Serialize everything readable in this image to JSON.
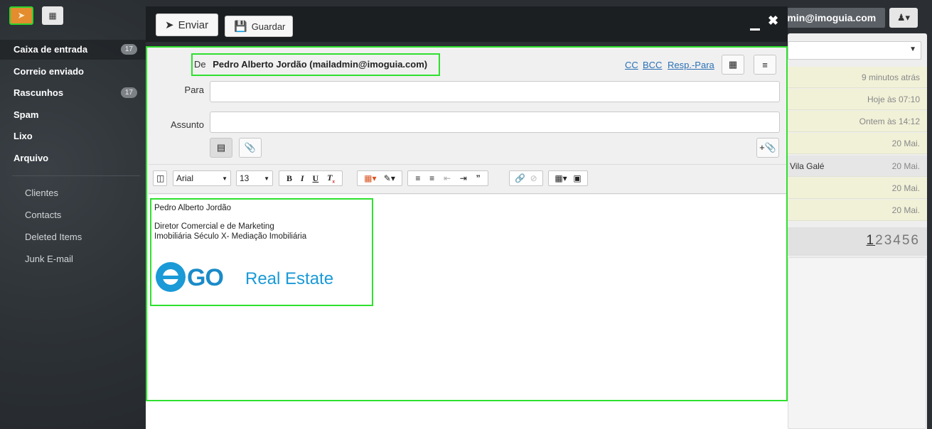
{
  "sidebar": {
    "folders": [
      {
        "label": "Caixa de entrada",
        "badge": "17"
      },
      {
        "label": "Correio enviado"
      },
      {
        "label": "Rascunhos",
        "badge": "17"
      },
      {
        "label": "Spam"
      },
      {
        "label": "Lixo"
      },
      {
        "label": "Arquivo"
      }
    ],
    "subfolders": [
      "Clientes",
      "Contacts",
      "Deleted Items",
      "Junk E-mail"
    ]
  },
  "user": {
    "email": "mailadmin@imoguia.com"
  },
  "message_list": {
    "rows": [
      {
        "subject": "",
        "when": "9 minutos atrás"
      },
      {
        "subject": "",
        "when": "Hoje às 07:10"
      },
      {
        "subject": "",
        "when": "Ontem às 14:12"
      },
      {
        "subject": "",
        "when": "20 Mai."
      },
      {
        "subject": "Vila Galé",
        "when": "20 Mai."
      },
      {
        "subject": "",
        "when": "20 Mai."
      },
      {
        "subject": "",
        "when": "20 Mai."
      }
    ],
    "pages": [
      "1",
      "2",
      "3",
      "4",
      "5",
      "6"
    ]
  },
  "compose": {
    "send_label": "Enviar",
    "save_label": "Guardar",
    "from_label": "De",
    "from_value": "Pedro Alberto Jordão (mailadmin@imoguia.com)",
    "cc_label": "CC",
    "bcc_label": "BCC",
    "reply_to_label": "Resp.-Para",
    "to_label": "Para",
    "to_value": "",
    "subject_label": "Assunto",
    "subject_value": ""
  },
  "editor_toolbar": {
    "font": "Arial",
    "size": "13"
  },
  "signature": {
    "name": "Pedro Alberto Jordão",
    "title": "Diretor Comercial e de Marketing",
    "company": "Imobiliária Século X- Mediação Imobiliária",
    "logo_text_1": "GO",
    "logo_text_2": "Real Estate"
  },
  "colors": {
    "accent_highlight": "#2ee02e",
    "compose_button": "#e38d2e",
    "logo_blue": "#1a9ad6"
  }
}
